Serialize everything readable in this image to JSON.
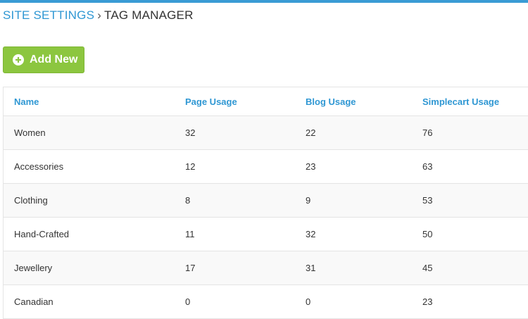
{
  "breadcrumb": {
    "parent": "SITE SETTINGS",
    "separator": "›",
    "current": "TAG MANAGER"
  },
  "toolbar": {
    "add_label": "Add New",
    "add_icon": "plus-circle-icon"
  },
  "colors": {
    "accent": "#2f97d3",
    "button_green": "#8cc63f"
  },
  "table": {
    "headers": [
      "Name",
      "Page Usage",
      "Blog Usage",
      "Simplecart Usage"
    ],
    "rows": [
      {
        "name": "Women",
        "page": "32",
        "blog": "22",
        "simplecart": "76"
      },
      {
        "name": "Accessories",
        "page": "12",
        "blog": "23",
        "simplecart": "63"
      },
      {
        "name": "Clothing",
        "page": "8",
        "blog": "9",
        "simplecart": "53"
      },
      {
        "name": "Hand-Crafted",
        "page": "11",
        "blog": "32",
        "simplecart": "50"
      },
      {
        "name": "Jewellery",
        "page": "17",
        "blog": "31",
        "simplecart": "45"
      },
      {
        "name": "Canadian",
        "page": "0",
        "blog": "0",
        "simplecart": "23"
      }
    ]
  }
}
